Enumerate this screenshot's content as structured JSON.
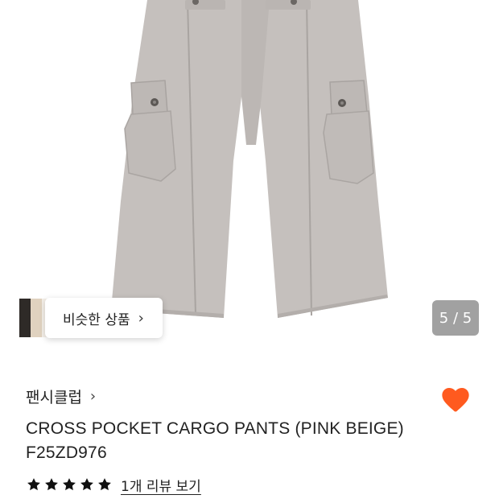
{
  "gallery": {
    "similar_label": "비슷한 상품",
    "similar_chevron": "›",
    "page_indicator": "5 / 5",
    "thumb_colors": [
      "#2e2a27",
      "#e6d8c6",
      "#f4efe8",
      "#ffffff"
    ]
  },
  "product": {
    "brand": "팬시클럽",
    "brand_chevron": "›",
    "title_line1": "CROSS POCKET CARGO PANTS (PINK BEIGE)",
    "title_line2": "F25ZD976",
    "wishlisted": true,
    "heart_color": "#ff5a1f",
    "rating_stars": 5,
    "review_link": "1개 리뷰 보기"
  },
  "colors": {
    "pants_fill": "#c5c0bd",
    "pants_shade": "#b3aeab",
    "seam": "#a39e9b"
  }
}
